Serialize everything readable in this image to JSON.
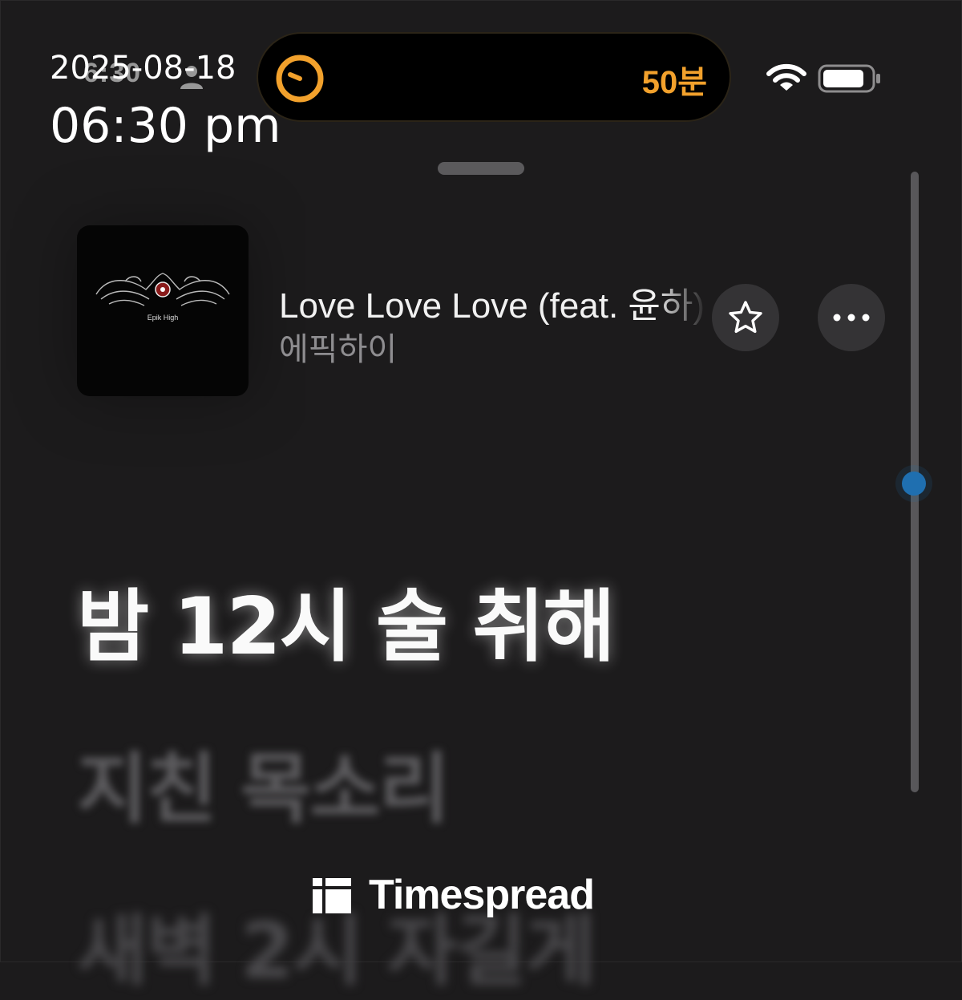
{
  "status_bar": {
    "time": "6:30",
    "timer": "50분",
    "timer_color": "#f2a12c",
    "icons": [
      "person-icon",
      "timer-ring-icon",
      "wifi-icon",
      "battery-icon"
    ]
  },
  "overlay": {
    "date": "2025-08-18",
    "time": "06:30 pm"
  },
  "now_playing": {
    "title": "Love Love Love (feat. 윤하)",
    "artist": "에픽하이",
    "album_art_text": "Epik High",
    "buttons": {
      "favorite_icon": "star-icon",
      "more_icon": "ellipsis-icon"
    }
  },
  "lyrics": {
    "current": "밤 12시 술 취해",
    "next": "지친 목소리",
    "after": "새벽 2시 자길게"
  },
  "watermark": {
    "brand": "Timespread"
  },
  "colors": {
    "background": "#1c1b1c",
    "accent_orange": "#f2a12c",
    "scroll_thumb": "#1f6fb0"
  }
}
